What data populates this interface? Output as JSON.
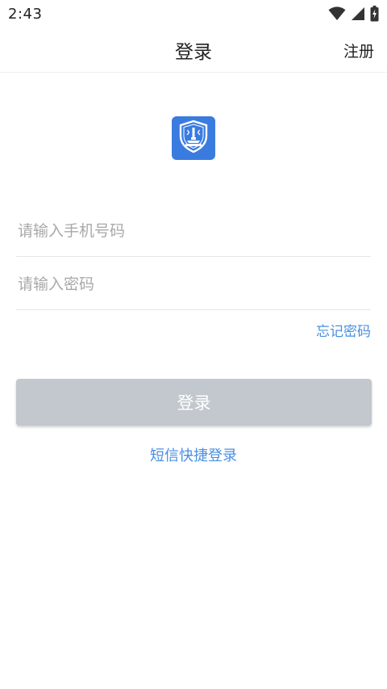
{
  "status_bar": {
    "time": "2:43",
    "icons": [
      "wifi-icon",
      "signal-icon",
      "battery-icon"
    ]
  },
  "app_bar": {
    "title": "登录",
    "register_label": "注册"
  },
  "logo": {
    "icon": "shield-emblem-icon",
    "color": "#3a7be0"
  },
  "form": {
    "phone_placeholder": "请输入手机号码",
    "phone_value": "",
    "password_placeholder": "请输入密码",
    "password_value": "",
    "forgot_password_label": "忘记密码",
    "login_button_label": "登录",
    "sms_login_label": "短信快捷登录"
  },
  "colors": {
    "accent": "#4a8fe2",
    "button_disabled": "#c3c8ce",
    "placeholder": "#a9a9a9"
  }
}
